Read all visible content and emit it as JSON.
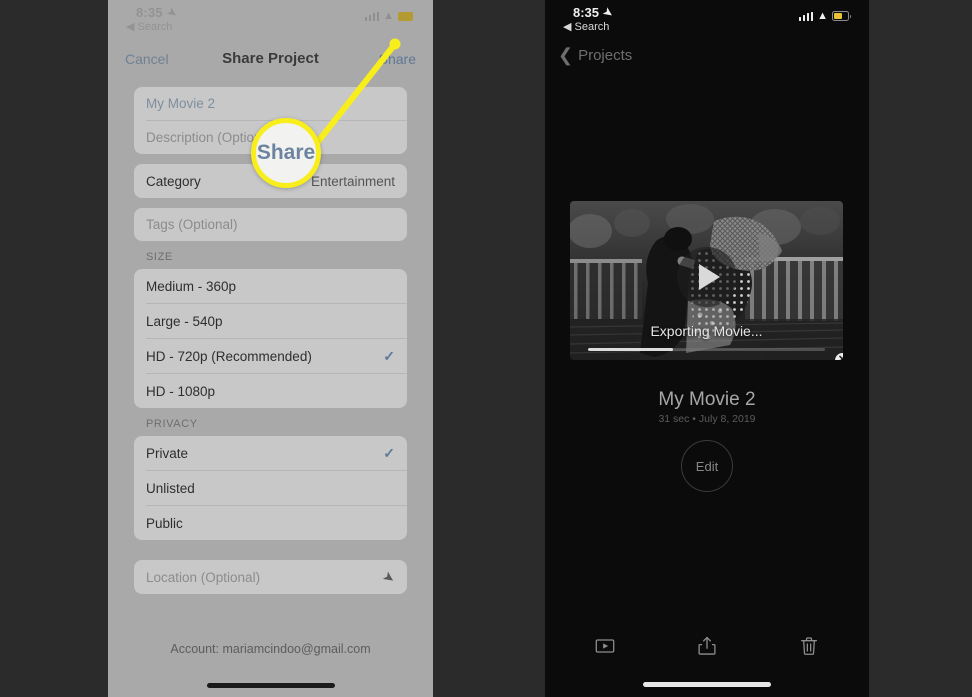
{
  "left_phone": {
    "status_bar": {
      "time": "8:35",
      "location_arrow": "location-arrow-icon",
      "back_app": "◀ Search",
      "signal": "signal-bars-icon",
      "wifi": "wifi-icon",
      "battery": "battery-icon"
    },
    "navbar": {
      "cancel": "Cancel",
      "title": "Share Project",
      "share": "Share"
    },
    "form": {
      "project_title": "My Movie 2",
      "description_placeholder": "Description (Optional)",
      "category_label": "Category",
      "category_value": "Entertainment",
      "tags_placeholder": "Tags (Optional)",
      "size_header": "SIZE",
      "size_options": [
        {
          "label": "Medium - 360p",
          "checked": false
        },
        {
          "label": "Large - 540p",
          "checked": false
        },
        {
          "label": "HD - 720p (Recommended)",
          "checked": true
        },
        {
          "label": "HD - 1080p",
          "checked": false
        }
      ],
      "privacy_header": "PRIVACY",
      "privacy_options": [
        {
          "label": "Private",
          "checked": true
        },
        {
          "label": "Unlisted",
          "checked": false
        },
        {
          "label": "Public",
          "checked": false
        }
      ],
      "location_placeholder": "Location (Optional)",
      "account_text": "Account: mariamcindoo@gmail.com",
      "check_mark": "✓"
    },
    "callout": {
      "magnified_label": "Share",
      "ring_color": "#f8ee1c",
      "line_color": "#f8ee1c"
    }
  },
  "right_phone": {
    "status_bar": {
      "time": "8:35",
      "back_app": "◀ Search"
    },
    "navbar": {
      "back_label": "Projects",
      "back_chevron": "❮"
    },
    "preview": {
      "export_status": "Exporting Movie...",
      "progress_percent": 36,
      "play_icon": "play-icon",
      "cancel_icon": "✕"
    },
    "project": {
      "title": "My Movie 2",
      "meta": "31 sec • July 8, 2019",
      "edit_label": "Edit"
    },
    "toolbar": {
      "play_icon": "play-video-icon",
      "share_icon": "share-icon",
      "delete_icon": "trash-icon"
    }
  },
  "colors": {
    "page_background": "#2b2b2b",
    "left_sheet_bg": "#a9a9a9",
    "left_card_bg": "#c8c8c8",
    "accent_blue": "#5b7a99",
    "highlight_yellow": "#f8ee1c",
    "right_bg": "#0b0b0b"
  }
}
